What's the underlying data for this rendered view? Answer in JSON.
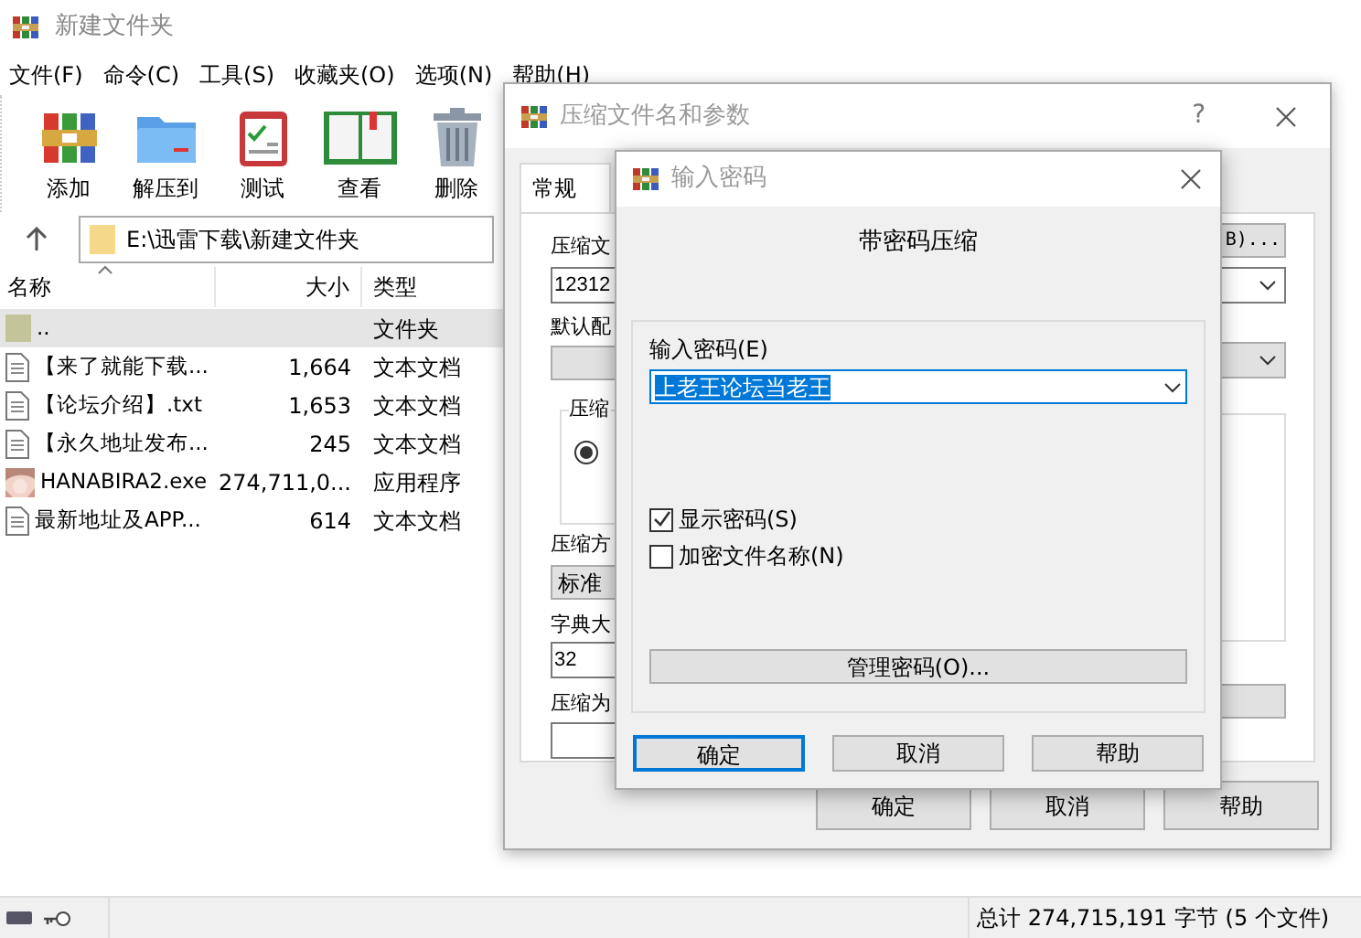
{
  "window": {
    "title": "新建文件夹"
  },
  "menu": [
    "文件(F)",
    "命令(C)",
    "工具(S)",
    "收藏夹(O)",
    "选项(N)",
    "帮助(H)"
  ],
  "toolbar": [
    {
      "label": "添加",
      "kind": "add"
    },
    {
      "label": "解压到",
      "kind": "extract"
    },
    {
      "label": "测试",
      "kind": "test"
    },
    {
      "label": "查看",
      "kind": "view"
    },
    {
      "label": "删除",
      "kind": "delete"
    }
  ],
  "address": "E:\\迅雷下载\\新建文件夹",
  "columns": [
    "名称",
    "大小",
    "类型"
  ],
  "rows": [
    {
      "name": "..",
      "type": "文件夹",
      "kind": "folder",
      "selected": true
    },
    {
      "name": "【来了就能下载...",
      "size": "1,664",
      "type": "文本文档",
      "kind": "text",
      "selected": false
    },
    {
      "name": "【论坛介绍】.txt",
      "size": "1,653",
      "type": "文本文档",
      "kind": "text",
      "selected": false
    },
    {
      "name": "【永久地址发布...",
      "size": "245",
      "type": "文本文档",
      "kind": "text",
      "selected": false
    },
    {
      "name": "HANABIRA2.exe",
      "size": "274,711,0...",
      "type": "应用程序",
      "kind": "exe",
      "selected": false
    },
    {
      "name": "最新地址及APP...",
      "size": "614",
      "type": "文本文档",
      "kind": "text",
      "selected": false
    }
  ],
  "status_bar": {
    "text": "总计 274,715,191 字节 (5 个文件)"
  },
  "archive_dialog": {
    "title": "压缩文件名和参数",
    "help_glyph": "?",
    "tabs": [
      {
        "label": "常规",
        "selected": true
      }
    ],
    "archive_name_label": "压缩文",
    "archive_name_value": "12312",
    "browse_button": "B)...",
    "profile_label": "默认配",
    "format_group_label": "压缩",
    "format_radio": {
      "selected": true
    },
    "method_label": "压缩方",
    "method_value": "标准",
    "dictionary_label": "字典大",
    "dictionary_value": "32",
    "split_label": "压缩为",
    "buttons": [
      "确定",
      "取消",
      "帮助"
    ]
  },
  "password_dialog": {
    "title": "输入密码",
    "heading": "带密码压缩",
    "password_label": "输入密码(E)",
    "password_value": "上老王论坛当老王",
    "checkboxes": [
      {
        "label": "显示密码(S)",
        "checked": true
      },
      {
        "label": "加密文件名称(N)",
        "checked": false
      }
    ],
    "manage_button": "管理密码(O)...",
    "buttons": [
      {
        "label": "确定",
        "default": true
      },
      {
        "label": "取消",
        "default": false
      },
      {
        "label": "帮助",
        "default": false
      }
    ]
  }
}
